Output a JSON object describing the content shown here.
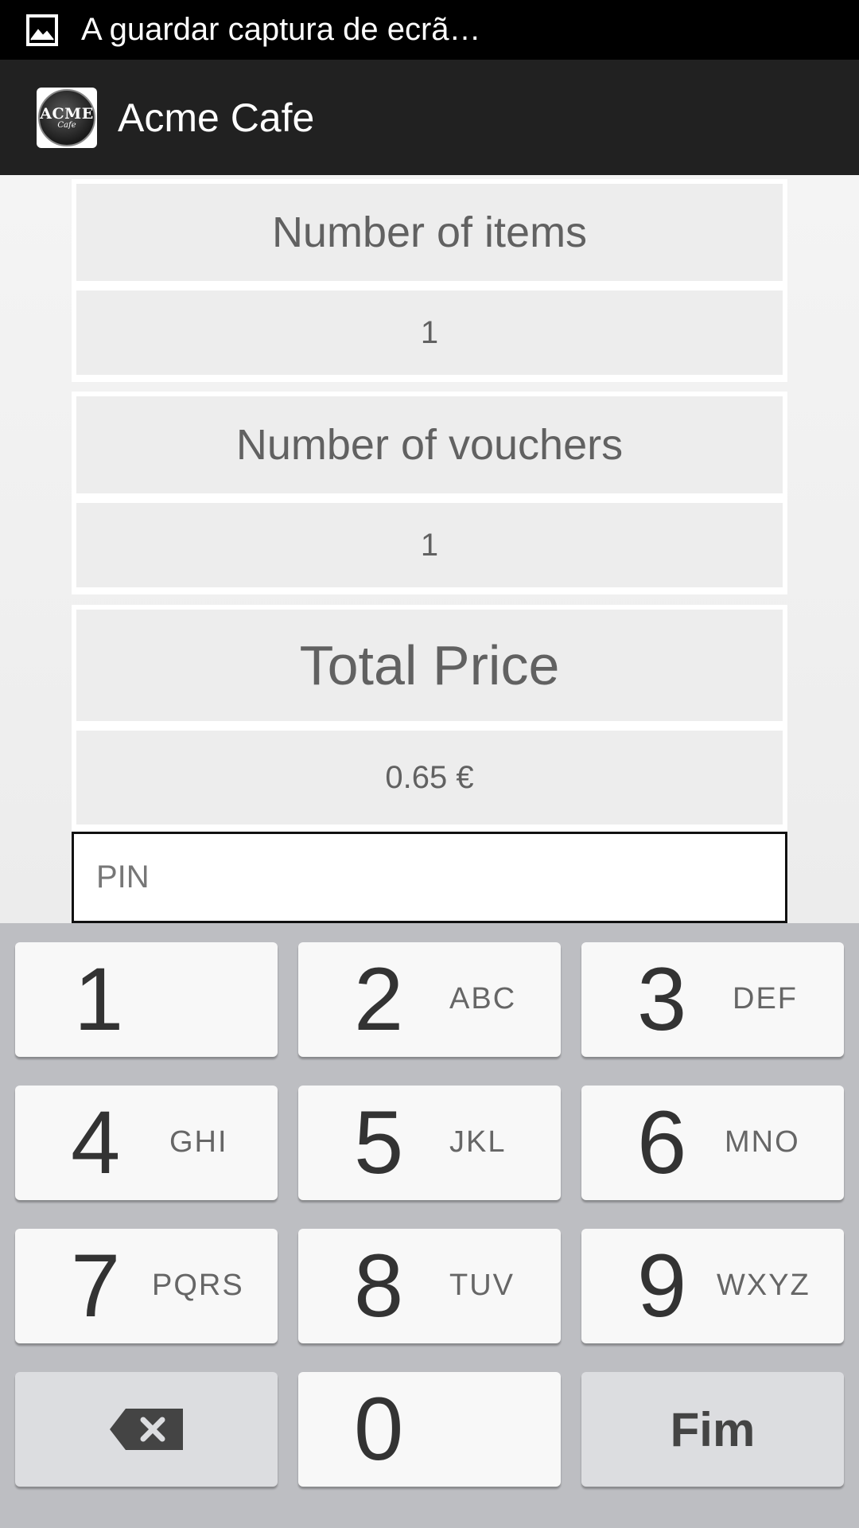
{
  "status_bar": {
    "notification_text": "A guardar captura de ecrã…",
    "icon": "image-icon"
  },
  "action_bar": {
    "title": "Acme Cafe",
    "logo_text": "ACME",
    "logo_subtext": "Cafe"
  },
  "form": {
    "items_label": "Number of items",
    "items_value": "1",
    "vouchers_label": "Number of vouchers",
    "vouchers_value": "1",
    "total_label": "Total Price",
    "total_value": "0.65 €",
    "pin_placeholder": "PIN"
  },
  "keypad": {
    "keys": [
      {
        "num": "1",
        "letters": ""
      },
      {
        "num": "2",
        "letters": "ABC"
      },
      {
        "num": "3",
        "letters": "DEF"
      },
      {
        "num": "4",
        "letters": "GHI"
      },
      {
        "num": "5",
        "letters": "JKL"
      },
      {
        "num": "6",
        "letters": "MNO"
      },
      {
        "num": "7",
        "letters": "PQRS"
      },
      {
        "num": "8",
        "letters": "TUV"
      },
      {
        "num": "9",
        "letters": "WXYZ"
      },
      {
        "num": "0",
        "letters": ""
      }
    ],
    "delete_icon": "backspace-icon",
    "done_label": "Fim"
  },
  "colors": {
    "status_bar_bg": "#000000",
    "action_bar_bg": "#212121",
    "keyboard_bg": "#bdbec2",
    "text_gray": "#616161"
  }
}
